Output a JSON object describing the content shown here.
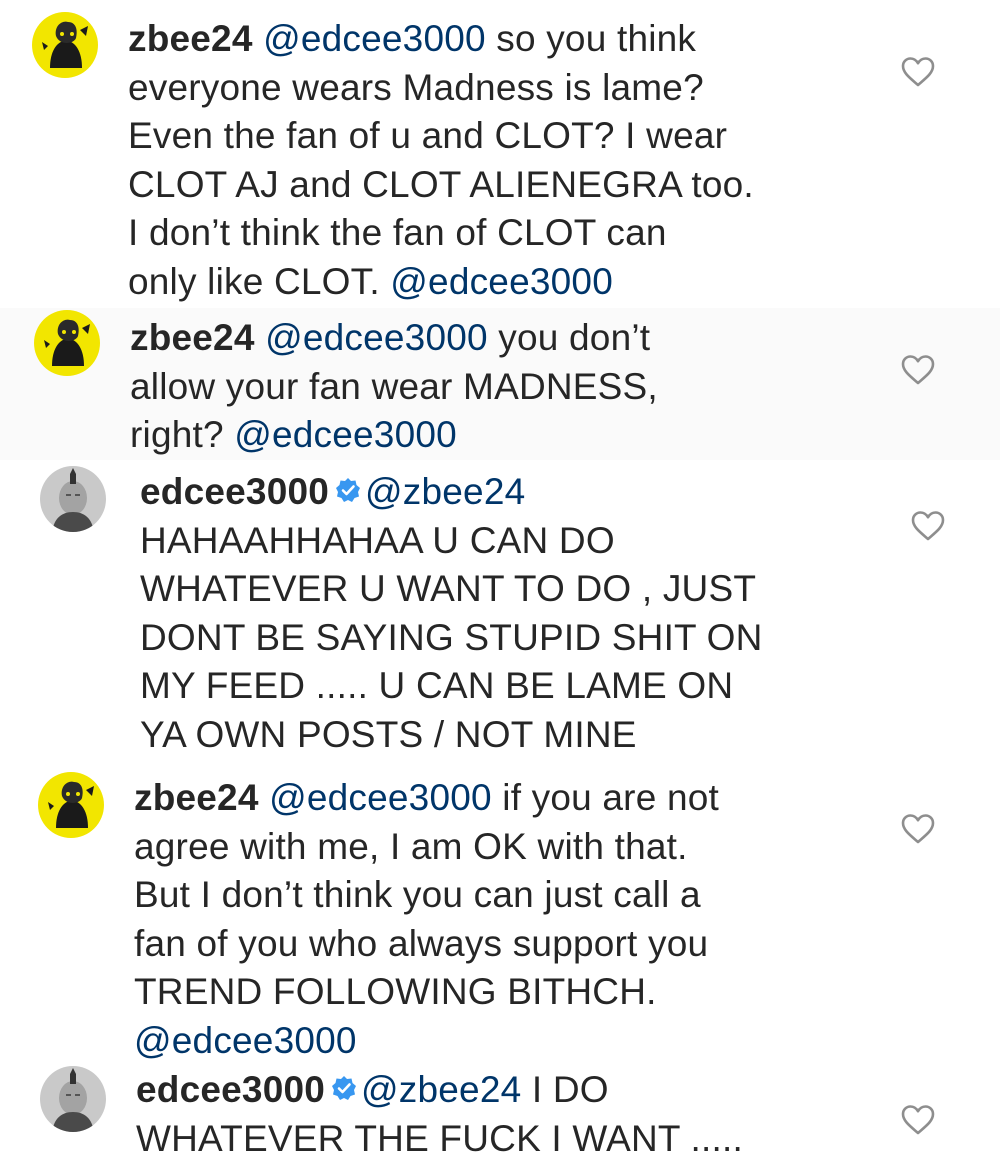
{
  "comments": [
    {
      "username": "zbee24",
      "avatar": "yellow-cartoon-avatar",
      "verified": false,
      "mention": "@edcee3000",
      "lines": [
        " so you think",
        "everyone wears Madness is lame?",
        "Even the fan of u and CLOT? I wear",
        "CLOT AJ and CLOT ALIENEGRA too.",
        "I don’t think the fan of CLOT can",
        "only like CLOT. "
      ],
      "trailing_mention": "@edcee3000"
    },
    {
      "username": "zbee24",
      "avatar": "yellow-cartoon-avatar",
      "verified": false,
      "mention": "@edcee3000",
      "lines": [
        " you don’t",
        "allow your fan wear MADNESS,",
        "right? "
      ],
      "trailing_mention": "@edcee3000"
    },
    {
      "username": "edcee3000",
      "avatar": "gray-portrait-avatar",
      "verified": true,
      "mention": "@zbee24",
      "lines": [
        "",
        "HAHAAHHAHAA U CAN DO",
        "WHATEVER U WANT TO DO , JUST",
        "DONT BE SAYING STUPID SHIT ON",
        "MY FEED ..... U CAN BE LAME ON",
        "YA OWN POSTS / NOT MINE"
      ],
      "trailing_mention": ""
    },
    {
      "username": "zbee24",
      "avatar": "yellow-cartoon-avatar",
      "verified": false,
      "mention": "@edcee3000",
      "lines": [
        " if you are not",
        "agree with me, I am OK with that.",
        "But I don’t think you can just call a",
        "fan of you who always support you",
        "TREND FOLLOWING BITHCH.",
        ""
      ],
      "trailing_mention": "@edcee3000"
    },
    {
      "username": "edcee3000",
      "avatar": "gray-portrait-avatar",
      "verified": true,
      "mention": "@zbee24",
      "lines": [
        " I DO",
        "WHATEVER THE FUCK I WANT ....."
      ],
      "trailing_mention": ""
    }
  ],
  "icons": {
    "like": "heart-outline-icon",
    "verified": "verified-badge-icon"
  },
  "colors": {
    "text": "#262626",
    "mention": "#003569",
    "verified": "#3897f0",
    "like_stroke": "#8e8e8e",
    "alt_row_background": "#fafafa"
  }
}
